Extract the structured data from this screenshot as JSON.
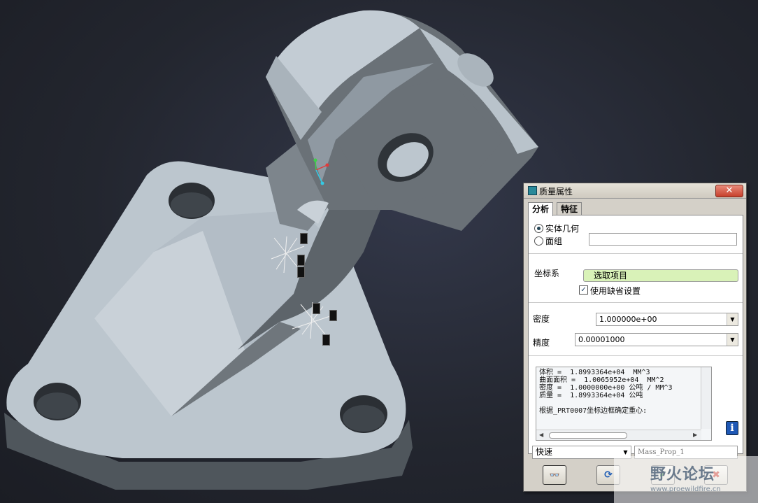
{
  "colors": {
    "background": "#23262f",
    "part_light": "#c3ccd4",
    "part_dark": "#6a7177",
    "selection_green": "#d9f2b8",
    "close_red": "#c7402c"
  },
  "dialog": {
    "title": "质量属性",
    "tabs": [
      {
        "label": "分析",
        "active": true
      },
      {
        "label": "特征",
        "active": false
      }
    ],
    "geometry": {
      "solid_label": "实体几何",
      "solid_selected": true,
      "quilt_label": "面组",
      "quilt_selected": false,
      "quilt_value": ""
    },
    "coordinate_system": {
      "label": "坐标系",
      "select_value": "选取项目",
      "use_default_label": "使用缺省设置",
      "use_default_checked": true
    },
    "density": {
      "label": "密度",
      "value": "1.000000e+00"
    },
    "precision": {
      "label": "精度",
      "value": "0.00001000"
    },
    "results_lines": [
      "体积 =  1.8993364e+04  MM^3",
      "曲面面积 =  1.0065952e+04  MM^2",
      "密度 =  1.0000000e+00 公吨 / MM^3",
      "质量 =  1.8993364e+04 公吨",
      "",
      "根据_PRT0007坐标边框确定重心:"
    ],
    "mode": {
      "value": "快速"
    },
    "name_input": {
      "placeholder": "Mass_Prop_1"
    },
    "icons": {
      "close": "close-icon",
      "preview": "glasses-icon",
      "repeat": "repeat-icon",
      "ok": "checkmark-icon",
      "cancel": "cancel-icon",
      "info": "info-icon"
    },
    "glyphs": {
      "close": "✕",
      "preview": "👓",
      "repeat": "⟳",
      "ok": "✔",
      "cancel": "✖",
      "info": "i",
      "arrow_down": "▼",
      "arrow_left": "◀",
      "arrow_right": "▶",
      "check": "✓"
    }
  },
  "watermark": {
    "text": "野火论坛",
    "url": "www.proewildfire.cn"
  }
}
